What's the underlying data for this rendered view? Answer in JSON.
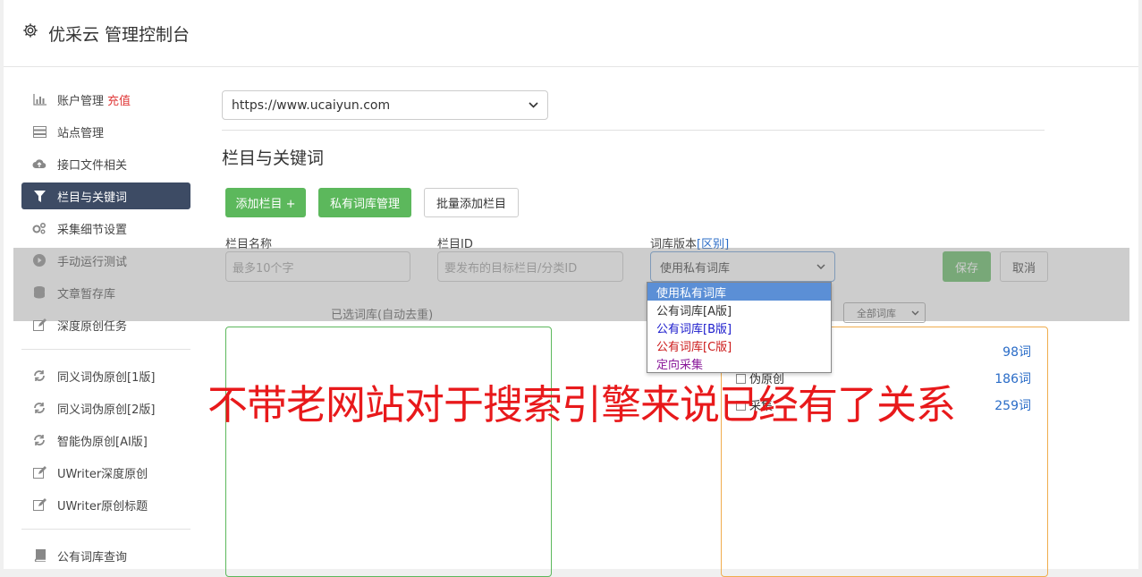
{
  "app": {
    "title": "优采云 管理控制台"
  },
  "sidebar": {
    "items": [
      {
        "label": "账户管理",
        "badge": "充值"
      },
      {
        "label": "站点管理"
      },
      {
        "label": "接口文件相关"
      },
      {
        "label": "栏目与关键词"
      },
      {
        "label": "采集细节设置"
      },
      {
        "label": "手动运行测试"
      },
      {
        "label": "文章暂存库"
      },
      {
        "label": "深度原创任务"
      },
      {
        "label": "同义词伪原创[1版]"
      },
      {
        "label": "同义词伪原创[2版]"
      },
      {
        "label": "智能伪原创[AI版]"
      },
      {
        "label": "UWriter深度原创"
      },
      {
        "label": "UWriter原创标题"
      },
      {
        "label": "公有词库查询"
      }
    ]
  },
  "main": {
    "site_select": "https://www.ucaiyun.com",
    "section_title": "栏目与关键词",
    "buttons": {
      "add_column": "添加栏目 +",
      "private_lib": "私有词库管理",
      "batch_add": "批量添加栏目"
    },
    "form": {
      "name_label": "栏目名称",
      "name_placeholder": "最多10个字",
      "id_label": "栏目ID",
      "id_placeholder": "要发布的目标栏目/分类ID",
      "version_label": "词库版本",
      "version_link": "[区别]",
      "version_value": "使用私有词库",
      "save": "保存",
      "cancel": "取消"
    },
    "selected_lib_label": "已选词库(自动去重)",
    "all_lib_select": "全部词库",
    "dropdown_options": [
      {
        "label": "使用私有词库",
        "color": "#ffffff"
      },
      {
        "label": "公有词库[A版]",
        "color": "#333333"
      },
      {
        "label": "公有词库[B版]",
        "color": "#1a1acc"
      },
      {
        "label": "公有词库[C版]",
        "color": "#cc1a1a"
      },
      {
        "label": "定向采集",
        "color": "#8a1a9a"
      }
    ],
    "library_rows": [
      {
        "name": "",
        "count": "98词"
      },
      {
        "name": "伪原创",
        "count": "186词"
      },
      {
        "name": "采集",
        "count": "259词"
      }
    ]
  },
  "overlay_caption": "不带老网站对于搜索引擎来说已经有了关系"
}
